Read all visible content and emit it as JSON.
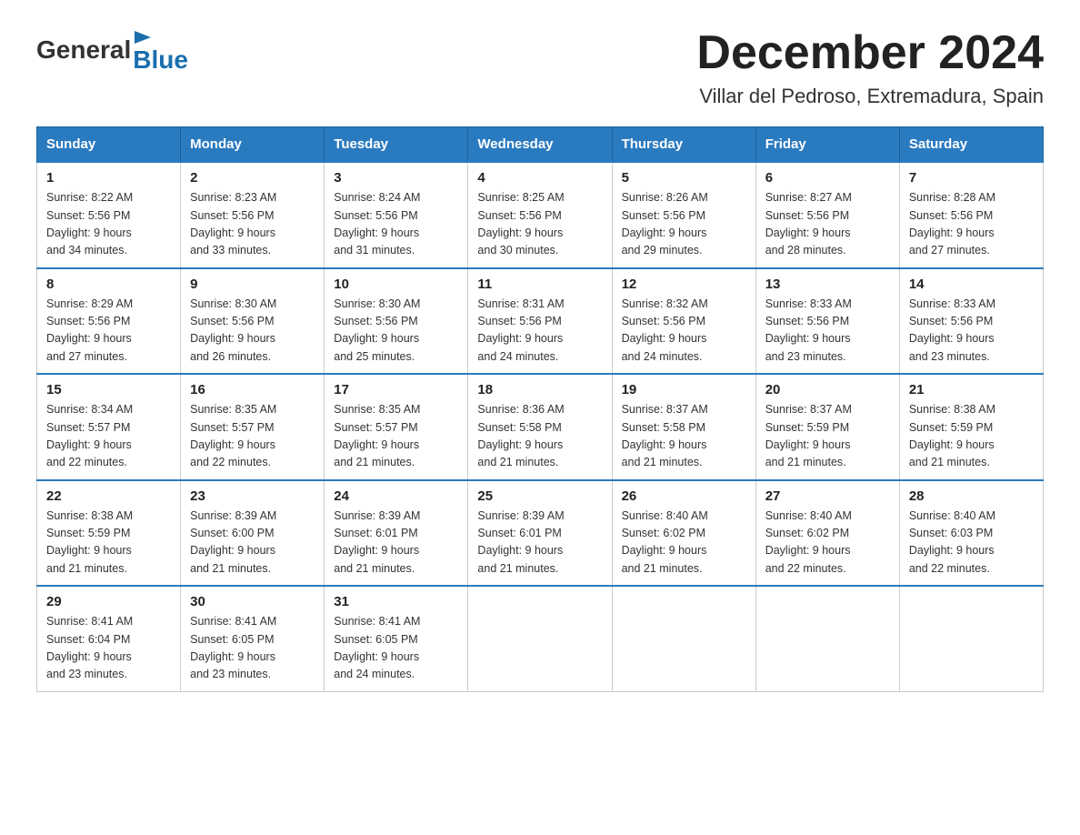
{
  "header": {
    "logo_general": "General",
    "logo_blue": "Blue",
    "title": "December 2024",
    "subtitle": "Villar del Pedroso, Extremadura, Spain"
  },
  "weekdays": [
    "Sunday",
    "Monday",
    "Tuesday",
    "Wednesday",
    "Thursday",
    "Friday",
    "Saturday"
  ],
  "weeks": [
    [
      {
        "day": "1",
        "sunrise": "8:22 AM",
        "sunset": "5:56 PM",
        "daylight": "9 hours and 34 minutes."
      },
      {
        "day": "2",
        "sunrise": "8:23 AM",
        "sunset": "5:56 PM",
        "daylight": "9 hours and 33 minutes."
      },
      {
        "day": "3",
        "sunrise": "8:24 AM",
        "sunset": "5:56 PM",
        "daylight": "9 hours and 31 minutes."
      },
      {
        "day": "4",
        "sunrise": "8:25 AM",
        "sunset": "5:56 PM",
        "daylight": "9 hours and 30 minutes."
      },
      {
        "day": "5",
        "sunrise": "8:26 AM",
        "sunset": "5:56 PM",
        "daylight": "9 hours and 29 minutes."
      },
      {
        "day": "6",
        "sunrise": "8:27 AM",
        "sunset": "5:56 PM",
        "daylight": "9 hours and 28 minutes."
      },
      {
        "day": "7",
        "sunrise": "8:28 AM",
        "sunset": "5:56 PM",
        "daylight": "9 hours and 27 minutes."
      }
    ],
    [
      {
        "day": "8",
        "sunrise": "8:29 AM",
        "sunset": "5:56 PM",
        "daylight": "9 hours and 27 minutes."
      },
      {
        "day": "9",
        "sunrise": "8:30 AM",
        "sunset": "5:56 PM",
        "daylight": "9 hours and 26 minutes."
      },
      {
        "day": "10",
        "sunrise": "8:30 AM",
        "sunset": "5:56 PM",
        "daylight": "9 hours and 25 minutes."
      },
      {
        "day": "11",
        "sunrise": "8:31 AM",
        "sunset": "5:56 PM",
        "daylight": "9 hours and 24 minutes."
      },
      {
        "day": "12",
        "sunrise": "8:32 AM",
        "sunset": "5:56 PM",
        "daylight": "9 hours and 24 minutes."
      },
      {
        "day": "13",
        "sunrise": "8:33 AM",
        "sunset": "5:56 PM",
        "daylight": "9 hours and 23 minutes."
      },
      {
        "day": "14",
        "sunrise": "8:33 AM",
        "sunset": "5:56 PM",
        "daylight": "9 hours and 23 minutes."
      }
    ],
    [
      {
        "day": "15",
        "sunrise": "8:34 AM",
        "sunset": "5:57 PM",
        "daylight": "9 hours and 22 minutes."
      },
      {
        "day": "16",
        "sunrise": "8:35 AM",
        "sunset": "5:57 PM",
        "daylight": "9 hours and 22 minutes."
      },
      {
        "day": "17",
        "sunrise": "8:35 AM",
        "sunset": "5:57 PM",
        "daylight": "9 hours and 21 minutes."
      },
      {
        "day": "18",
        "sunrise": "8:36 AM",
        "sunset": "5:58 PM",
        "daylight": "9 hours and 21 minutes."
      },
      {
        "day": "19",
        "sunrise": "8:37 AM",
        "sunset": "5:58 PM",
        "daylight": "9 hours and 21 minutes."
      },
      {
        "day": "20",
        "sunrise": "8:37 AM",
        "sunset": "5:59 PM",
        "daylight": "9 hours and 21 minutes."
      },
      {
        "day": "21",
        "sunrise": "8:38 AM",
        "sunset": "5:59 PM",
        "daylight": "9 hours and 21 minutes."
      }
    ],
    [
      {
        "day": "22",
        "sunrise": "8:38 AM",
        "sunset": "5:59 PM",
        "daylight": "9 hours and 21 minutes."
      },
      {
        "day": "23",
        "sunrise": "8:39 AM",
        "sunset": "6:00 PM",
        "daylight": "9 hours and 21 minutes."
      },
      {
        "day": "24",
        "sunrise": "8:39 AM",
        "sunset": "6:01 PM",
        "daylight": "9 hours and 21 minutes."
      },
      {
        "day": "25",
        "sunrise": "8:39 AM",
        "sunset": "6:01 PM",
        "daylight": "9 hours and 21 minutes."
      },
      {
        "day": "26",
        "sunrise": "8:40 AM",
        "sunset": "6:02 PM",
        "daylight": "9 hours and 21 minutes."
      },
      {
        "day": "27",
        "sunrise": "8:40 AM",
        "sunset": "6:02 PM",
        "daylight": "9 hours and 22 minutes."
      },
      {
        "day": "28",
        "sunrise": "8:40 AM",
        "sunset": "6:03 PM",
        "daylight": "9 hours and 22 minutes."
      }
    ],
    [
      {
        "day": "29",
        "sunrise": "8:41 AM",
        "sunset": "6:04 PM",
        "daylight": "9 hours and 23 minutes."
      },
      {
        "day": "30",
        "sunrise": "8:41 AM",
        "sunset": "6:05 PM",
        "daylight": "9 hours and 23 minutes."
      },
      {
        "day": "31",
        "sunrise": "8:41 AM",
        "sunset": "6:05 PM",
        "daylight": "9 hours and 24 minutes."
      },
      null,
      null,
      null,
      null
    ]
  ],
  "labels": {
    "sunrise": "Sunrise:",
    "sunset": "Sunset:",
    "daylight": "Daylight:"
  }
}
